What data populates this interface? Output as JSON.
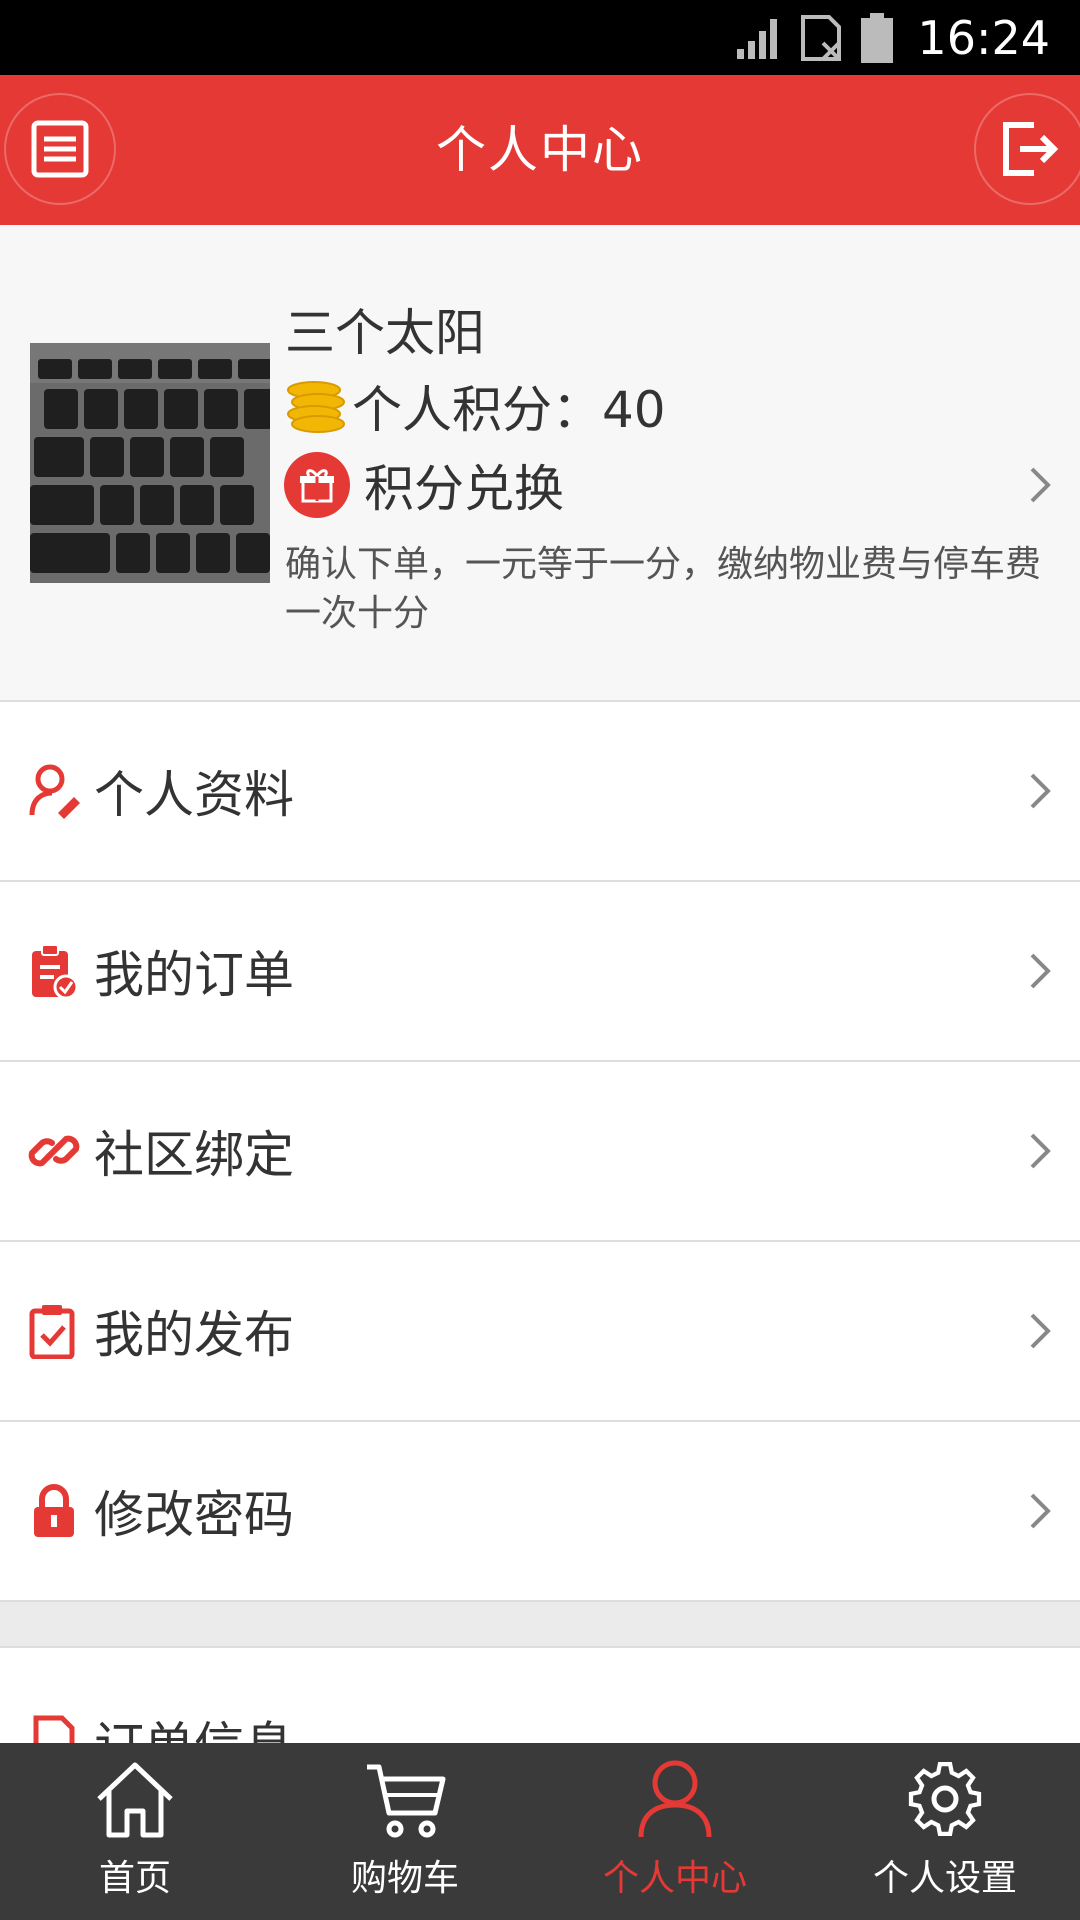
{
  "status_bar": {
    "time": "16:24"
  },
  "header": {
    "title": "个人中心",
    "left_icon": "list-icon",
    "right_icon": "logout-icon"
  },
  "profile": {
    "username": "三个太阳",
    "points_label": "个人积分：40",
    "exchange_label": "积分兑换",
    "description": "确认下单，一元等于一分，缴纳物业费与停车费一次十分"
  },
  "menu": {
    "items": [
      {
        "label": "个人资料",
        "icon": "user-edit-icon"
      },
      {
        "label": "我的订单",
        "icon": "order-clipboard-icon"
      },
      {
        "label": "社区绑定",
        "icon": "link-icon"
      },
      {
        "label": "我的发布",
        "icon": "publish-clipboard-icon"
      },
      {
        "label": "修改密码",
        "icon": "lock-icon"
      },
      {
        "label": "订单信息",
        "icon": "document-icon"
      }
    ]
  },
  "nav": {
    "items": [
      {
        "label": "首页",
        "icon": "home-icon",
        "active": false
      },
      {
        "label": "购物车",
        "icon": "cart-icon",
        "active": false
      },
      {
        "label": "个人中心",
        "icon": "person-icon",
        "active": true
      },
      {
        "label": "个人设置",
        "icon": "gear-icon",
        "active": false
      }
    ]
  },
  "colors": {
    "accent": "#e53935",
    "nav_bg": "#3a3a3a",
    "coin": "#f2b705"
  }
}
